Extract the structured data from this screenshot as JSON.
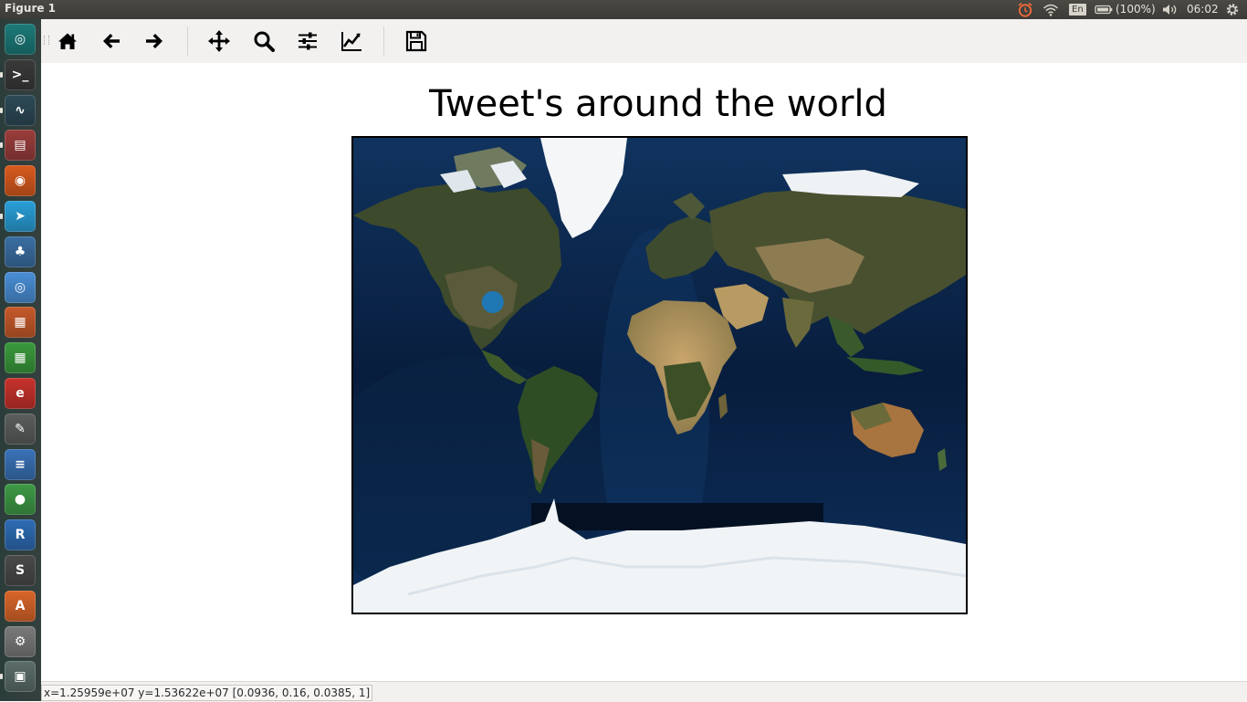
{
  "window": {
    "title": "Figure 1"
  },
  "top_panel": {
    "icons": [
      "alarm-clock-icon",
      "wifi-icon",
      "battery-icon",
      "volume-icon",
      "gear-icon"
    ],
    "keyboard_layout": "En",
    "battery": "(100%)",
    "time": "06:02"
  },
  "launcher": {
    "items": [
      {
        "name": "ubuntu-dash-icon",
        "glyph": "◎",
        "color": "#1c7a78"
      },
      {
        "name": "terminal-icon",
        "glyph": ">_",
        "color": "#3a3a3a"
      },
      {
        "name": "system-monitor-icon",
        "glyph": "∿",
        "color": "#2d4a57"
      },
      {
        "name": "file-manager-icon",
        "glyph": "▤",
        "color": "#9a3e3c"
      },
      {
        "name": "firefox-icon",
        "glyph": "◉",
        "color": "#d85a1e"
      },
      {
        "name": "telegram-icon",
        "glyph": "➤",
        "color": "#2a9fd8"
      },
      {
        "name": "python-icon",
        "glyph": "♣",
        "color": "#3a6fa3"
      },
      {
        "name": "chromium-icon",
        "glyph": "◎",
        "color": "#4a8fd6"
      },
      {
        "name": "impress-icon",
        "glyph": "▦",
        "color": "#c65a2b"
      },
      {
        "name": "calc-icon",
        "glyph": "▦",
        "color": "#3a9a3c"
      },
      {
        "name": "pdf-viewer-icon",
        "glyph": "e",
        "color": "#c8322c"
      },
      {
        "name": "text-editor-icon",
        "glyph": "✎",
        "color": "#5a5e5c"
      },
      {
        "name": "writer-icon",
        "glyph": "≡",
        "color": "#3a72b7"
      },
      {
        "name": "globe-icon",
        "glyph": "●",
        "color": "#3e9a46"
      },
      {
        "name": "r-studio-icon",
        "glyph": "R",
        "color": "#2e6cb4"
      },
      {
        "name": "sublime-text-icon",
        "glyph": "S",
        "color": "#4a4a4a"
      },
      {
        "name": "software-center-icon",
        "glyph": "A",
        "color": "#d9662a"
      },
      {
        "name": "system-settings-icon",
        "glyph": "⚙",
        "color": "#7a7a7a"
      },
      {
        "name": "screenshot-icon",
        "glyph": "▣",
        "color": "#5c6e6a"
      }
    ]
  },
  "toolbar": {
    "buttons": [
      "home-button",
      "back-button",
      "forward-button",
      "pan-button",
      "zoom-button",
      "configure-subplots-button",
      "edit-axes-button",
      "save-button"
    ]
  },
  "figure": {
    "title": "Tweet's around the world",
    "map": {
      "markers": [
        {
          "lon": -98,
          "lat": 40,
          "color": "#1f77b4"
        }
      ]
    }
  },
  "statusbar": {
    "text": "x=1.25959e+07  y=1.53622e+07  [0.0936, 0.16, 0.0385, 1]"
  }
}
